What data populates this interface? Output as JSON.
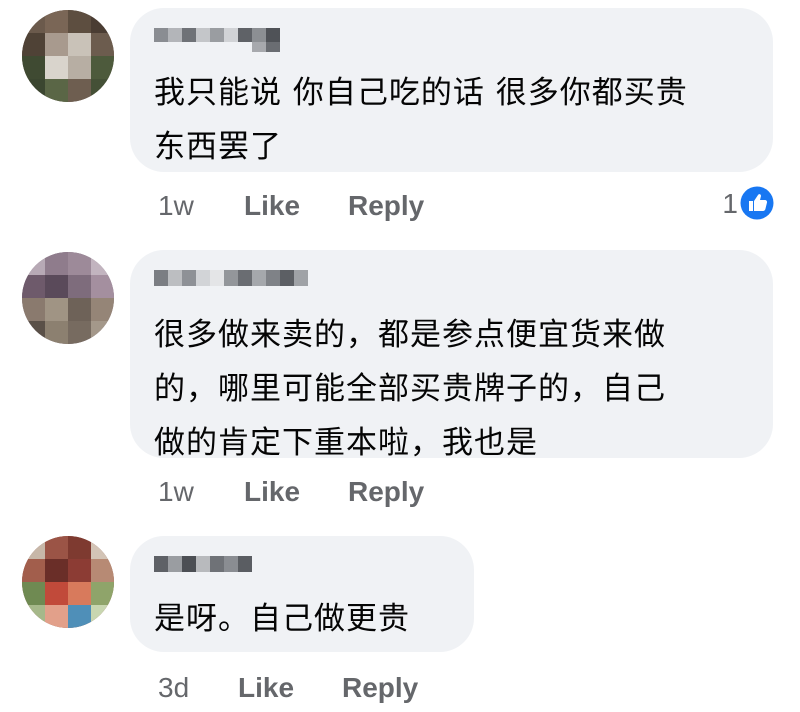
{
  "comments": [
    {
      "author_name": "",
      "text": "我只能说 你自己吃的话 很多你都买贵\n东西罢了",
      "time": "1w",
      "like_label": "Like",
      "reply_label": "Reply",
      "reaction_count": "1",
      "reaction_icon": "like-icon",
      "avatar_icon": "avatar-pixelated"
    },
    {
      "author_name": "",
      "text": "很多做来卖的，都是参点便宜货来做\n的，哪里可能全部买贵牌子的，自己\n做的肯定下重本啦，我也是",
      "time": "1w",
      "like_label": "Like",
      "reply_label": "Reply",
      "avatar_icon": "avatar-pixelated"
    },
    {
      "author_name": "",
      "text": "是呀。自己做更贵",
      "time": "3d",
      "like_label": "Like",
      "reply_label": "Reply",
      "avatar_icon": "avatar-pixelated"
    }
  ],
  "colors": {
    "bubble": "#f0f2f5",
    "meta_text": "#65676b",
    "like_blue": "#1877f2"
  }
}
